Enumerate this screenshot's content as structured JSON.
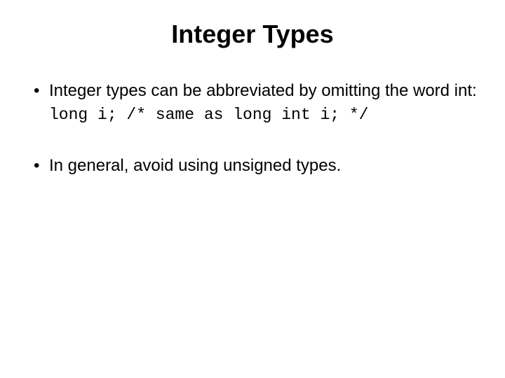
{
  "title": "Integer Types",
  "bullets": {
    "b1": "Integer types can be abbreviated by omitting the word int:",
    "code": "long i; /* same as long int i; */",
    "b2": "In general, avoid using unsigned types."
  }
}
